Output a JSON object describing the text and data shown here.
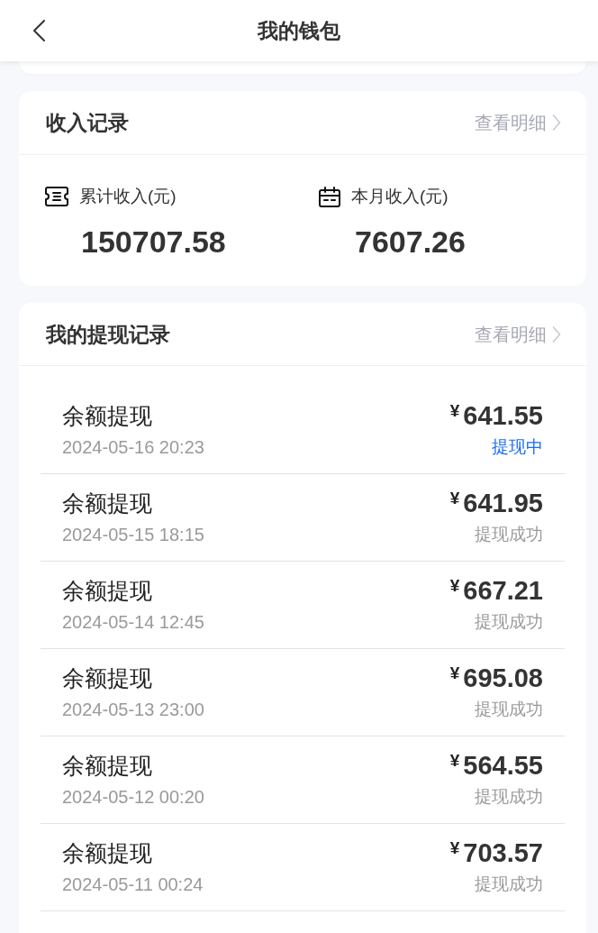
{
  "header": {
    "title": "我的钱包"
  },
  "income": {
    "title": "收入记录",
    "link": "查看明细",
    "stats": [
      {
        "kind": "total",
        "label": "累计收入(元)",
        "value": "150707.58"
      },
      {
        "kind": "month",
        "label": "本月收入(元)",
        "value": "7607.26"
      }
    ]
  },
  "withdrawals": {
    "title": "我的提现记录",
    "link": "查看明细",
    "records": [
      {
        "title": "余额提现",
        "time": "2024-05-16 20:23",
        "currency": "¥",
        "amount": "641.55",
        "status": "提现中",
        "pending": true
      },
      {
        "title": "余额提现",
        "time": "2024-05-15 18:15",
        "currency": "¥",
        "amount": "641.95",
        "status": "提现成功",
        "pending": false
      },
      {
        "title": "余额提现",
        "time": "2024-05-14 12:45",
        "currency": "¥",
        "amount": "667.21",
        "status": "提现成功",
        "pending": false
      },
      {
        "title": "余额提现",
        "time": "2024-05-13 23:00",
        "currency": "¥",
        "amount": "695.08",
        "status": "提现成功",
        "pending": false
      },
      {
        "title": "余额提现",
        "time": "2024-05-12 00:20",
        "currency": "¥",
        "amount": "564.55",
        "status": "提现成功",
        "pending": false
      },
      {
        "title": "余额提现",
        "time": "2024-05-11 00:24",
        "currency": "¥",
        "amount": "703.57",
        "status": "提现成功",
        "pending": false
      }
    ]
  }
}
